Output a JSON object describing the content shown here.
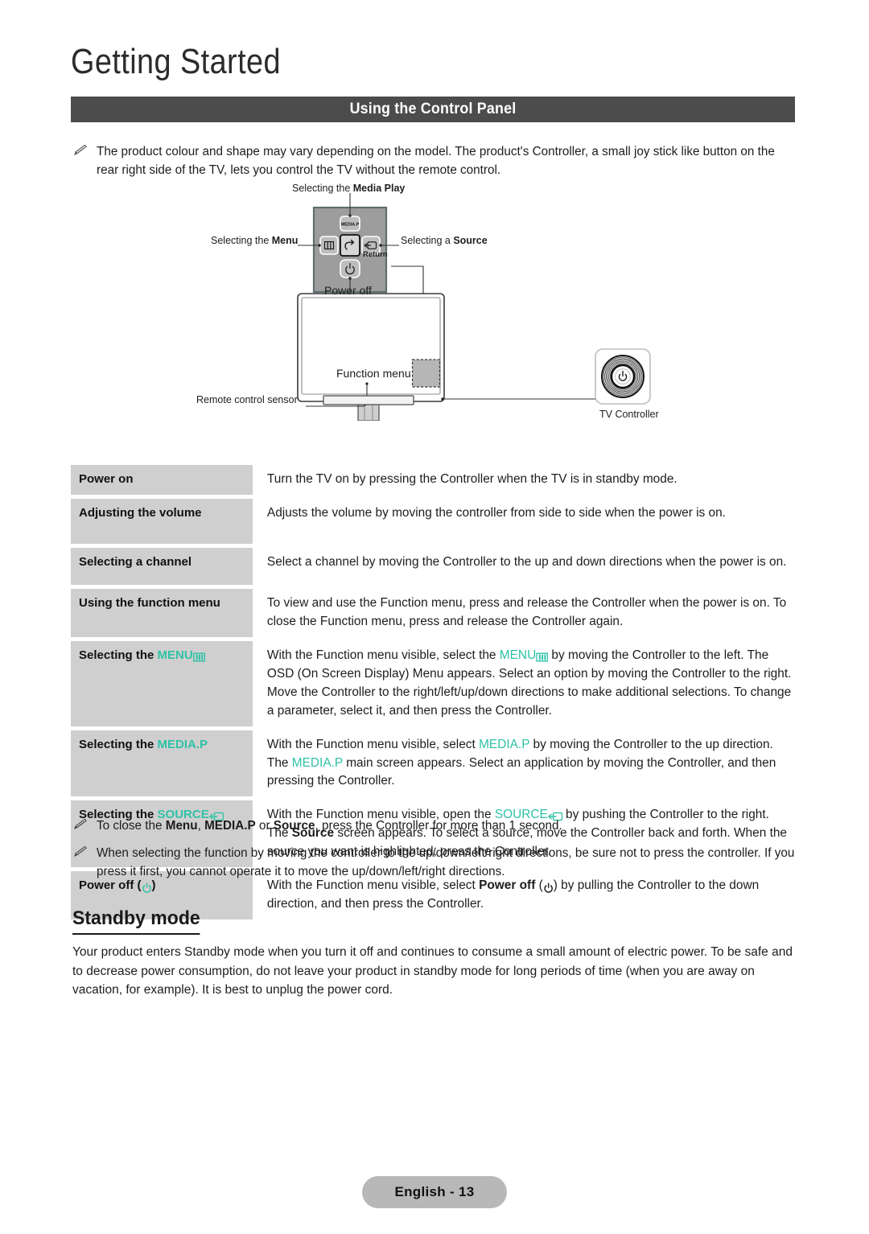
{
  "page": {
    "chapter_title": "Getting Started",
    "section_title": "Using the Control Panel",
    "footer_label": "English - 13"
  },
  "colors": {
    "accent_teal": "#2ec2a6",
    "section_bar": "#4c4c4c",
    "table_term_bg": "#cfcfcf",
    "footer_pill_bg": "#b8b8b8"
  },
  "notes": {
    "intro": "The product colour and shape may vary depending on the model. The product's Controller, a small joy stick like button on the rear right side of the TV, lets you control the TV without the remote control.",
    "close_prefix": "To close the ",
    "close_menu": "Menu",
    "close_comma": ", ",
    "close_mediap": "MEDIA.P",
    "close_or": " or ",
    "close_source": "Source",
    "close_suffix": ", press the Controller for more than 1 second.",
    "press_warning": "When selecting the function by moving the controller to the up/down/left/right directions, be sure not to press the controller. If you press it first, you cannot operate it to move the up/down/left/right directions."
  },
  "diagram": {
    "labels": {
      "media_play_prefix": "Selecting the ",
      "media_play_bold": "Media Play",
      "menu_prefix": "Selecting the ",
      "menu_bold": "Menu",
      "source_prefix": "Selecting a ",
      "source_bold": "Source",
      "power_off": "Power off",
      "function_menu": "Function menu",
      "remote_sensor": "Remote control sensor",
      "tv_controller": "TV Controller",
      "return": "Return",
      "mediap_button": "MEDIA.P"
    },
    "icons": {
      "up": "media-play-icon",
      "left": "menu-icon",
      "right": "source-icon",
      "center": "return-icon",
      "down": "power-icon",
      "controller": "tv-controller-dial-icon"
    }
  },
  "table": {
    "rows": [
      {
        "term_plain": "Power on",
        "term_kind": "plain",
        "desc": "Turn the TV on by pressing the Controller when the TV is in standby mode.",
        "desc_kind": "plain",
        "term_height": 34,
        "desc_height": 34
      },
      {
        "term_plain": "Adjusting the volume",
        "term_kind": "plain",
        "desc": "Adjusts the volume by moving the controller from side to side when the power is on.",
        "desc_kind": "plain",
        "term_height": 56,
        "desc_height": 56
      },
      {
        "term_plain": "Selecting a channel",
        "term_kind": "plain",
        "desc": "Select a channel by moving the Controller to the up and down directions when the power is on.",
        "desc_kind": "plain",
        "term_height": 46,
        "desc_height": 46
      },
      {
        "term_plain": "Using the function menu",
        "term_kind": "plain",
        "desc": "To view and use the Function menu, press and release the Controller when the power is on. To close the Function menu, press and release the Controller again.",
        "desc_kind": "plain",
        "term_height": 46,
        "desc_height": 46
      },
      {
        "term_kind": "menu",
        "term_prefix": "Selecting the ",
        "term_accent": "MENU",
        "desc_kind": "menu",
        "desc_part1": "With the Function menu visible, select the ",
        "desc_accent": "MENU",
        "desc_part2": " by moving the Controller to the left. The OSD (On Screen Display) Menu appears. Select an option by moving the Controller to the right. Move the Controller to the right/left/up/down directions to make additional selections. To change a parameter, select it, and then press the Controller.",
        "term_height": 72,
        "desc_height": 72
      },
      {
        "term_kind": "mediap",
        "term_prefix": "Selecting the ",
        "term_accent": "MEDIA.P",
        "desc_kind": "mediap",
        "desc_part1": "With the Function menu visible, select ",
        "desc_accent": "MEDIA.P",
        "desc_part2": " by moving the Controller to the up direction. The ",
        "desc_accent2": "MEDIA.P",
        "desc_part3": " main screen appears. Select an application by moving the Controller, and then pressing the Controller.",
        "term_height": 55,
        "desc_height": 55
      },
      {
        "term_kind": "source",
        "term_prefix": "Selecting the ",
        "term_accent": "SOURCE",
        "desc_kind": "source",
        "desc_part1": "With the Function menu visible, open the ",
        "desc_accent": "SOURCE",
        "desc_part2": " by pushing the Controller to the right. The ",
        "desc_bold": "Source",
        "desc_part3": " screen appears. To select a source, move the Controller back and forth. When the source you want is highlighted, press the Controller.",
        "term_height": 55,
        "desc_height": 55
      },
      {
        "term_kind": "poweroff",
        "term_prefix": "Power off (",
        "term_suffix": ")",
        "desc_kind": "poweroff",
        "desc_part1": "With the Function menu visible, select ",
        "desc_bold": "Power off",
        "desc_part2": " (",
        "desc_part3": ") by pulling the Controller to the down direction, and then press the Controller.",
        "term_height": 44,
        "desc_height": 44
      }
    ]
  },
  "standby": {
    "heading": "Standby mode",
    "paragraph": "Your product enters Standby mode when you turn it off and continues to consume a small amount of electric power. To be safe and to decrease power consumption, do not leave your product in standby mode for long periods of time (when you are away on vacation, for example). It is best to unplug the power cord."
  }
}
